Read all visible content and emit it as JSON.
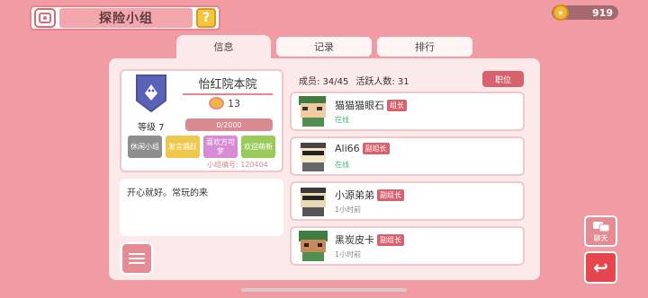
{
  "header": {
    "title": "探险小组",
    "help_label": "?",
    "currency_value": "919"
  },
  "tabs": [
    {
      "label": "信息",
      "active": true
    },
    {
      "label": "记录",
      "active": false
    },
    {
      "label": "排行",
      "active": false
    }
  ],
  "group": {
    "name": "怡红院本院",
    "rating": "13",
    "level_label": "等级 7",
    "exp_text": "0/2000",
    "tags": [
      {
        "label": "休闲小组",
        "color": "#8e8e8e"
      },
      {
        "label": "发言踊跃",
        "color": "#eec84a"
      },
      {
        "label": "喜欢方可梦",
        "color": "#d98bd6"
      },
      {
        "label": "欢迎萌新",
        "color": "#9acb5a"
      }
    ],
    "group_no": "小组编号: 120404",
    "motto": "开心就好。常玩的来"
  },
  "members_panel": {
    "member_count": "成员: 34/45",
    "active_count": "活跃人数: 31",
    "role_button": "职位",
    "members": [
      {
        "name": "猫猫猫眼石",
        "role": "组长",
        "status": "在线",
        "online": true,
        "avatar": "green-hat"
      },
      {
        "name": "Ali66",
        "role": "副组长",
        "status": "在线",
        "online": true,
        "avatar": "sunglasses"
      },
      {
        "name": "小源弟弟",
        "role": "副组长",
        "status": "1小时前",
        "online": false,
        "avatar": "sunglasses-dark"
      },
      {
        "name": "黑炭皮卡",
        "role": "副组长",
        "status": "1小时前",
        "online": false,
        "avatar": "green-beanie"
      }
    ]
  },
  "side": {
    "chat_label": "聊天",
    "back_label": "↩"
  },
  "colors": {
    "background": "#f19ca3",
    "accent": "#d7616d",
    "online": "#42b96a"
  }
}
